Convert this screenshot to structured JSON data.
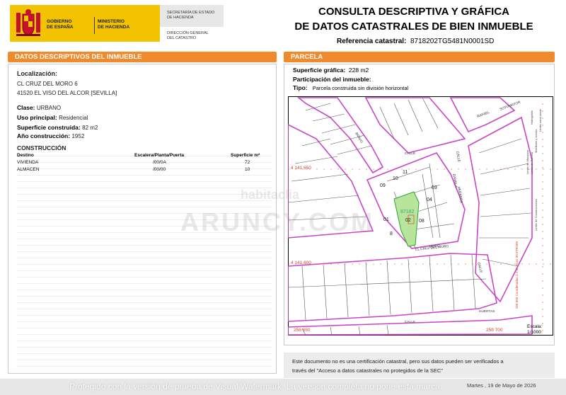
{
  "header": {
    "gov_line1": "GOBIERNO",
    "gov_line2": "DE ESPAÑA",
    "ministry_line1": "MINISTERIO",
    "ministry_line2": "DE HACIENDA",
    "secretaria_line1": "SECRETARÍA DE ESTADO",
    "secretaria_line2": "DE HACIENDA",
    "direccion_line1": "DIRECCIÓN GENERAL",
    "direccion_line2": "DEL CATASTRO",
    "title_line1": "CONSULTA DESCRIPTIVA Y GRÁFICA",
    "title_line2": "DE DATOS CATASTRALES DE BIEN INMUEBLE",
    "ref_label": "Referencia catastral:",
    "ref_value": "8718202TG5481N0001SD",
    "accent_color": "#f08a2c",
    "gov_color": "#f3c200"
  },
  "left": {
    "section_title": "DATOS DESCRIPTIVOS DEL INMUEBLE",
    "localizacion_label": "Localización:",
    "address_line1": "CL CRUZ DEL MORO 6",
    "address_line2": "41520 EL VISO DEL ALCOR [SEVILLA]",
    "clase_label": "Clase:",
    "clase_value": "URBANO",
    "uso_label": "Uso principal:",
    "uso_value": "Residencial",
    "sup_label": "Superficie construida:",
    "sup_value": "82 m2",
    "ano_label": "Año construcción:",
    "ano_value": "1952",
    "construccion_label": "CONSTRUCCIÓN",
    "table": {
      "headers": [
        "Destino",
        "Escalera/Planta/Puerta",
        "Superficie m²"
      ],
      "rows": [
        [
          "VIVIENDA",
          "/00/0A",
          "72"
        ],
        [
          "ALMACEN",
          "/00/00",
          "10"
        ]
      ]
    }
  },
  "right": {
    "section_title": "PARCELA",
    "sup_label": "Superficie gráfica:",
    "sup_value": "228 m2",
    "part_label": "Participación del inmueble:",
    "tipo_label": "Tipo:",
    "tipo_value": "Parcela construida sin división horizontal",
    "scale_label": "Escala:",
    "scale_value": "1/1000"
  },
  "map": {
    "coord_north": "4 141 650",
    "coord_south": "4 141 600",
    "coord_bottom_left": "258 650",
    "coord_bottom_right": "258 700",
    "parcel_ref": "87182",
    "streets": [
      "CALLE",
      "RAFAEL",
      "SOTOMAYOR",
      "CALLE",
      "RAMBLA",
      "HERRERA",
      "CL CRUZ DEL MORO",
      "HUERTAS",
      "CALLE",
      "CALLE",
      "BRAVO",
      "MORO"
    ],
    "plot_numbers": [
      "09",
      "10",
      "11",
      "03",
      "04",
      "01",
      "02",
      "08",
      "8"
    ],
    "legend": [
      "Límite de Manzana",
      "Límite de Parcela",
      "Límite de Construcciones",
      "Mobiliario y aceras",
      "Límite zona verde",
      "Hidrografía"
    ],
    "side_note": "258 650 Coordenadas U.T.M. Huso 30 ETRS89",
    "line_color": "#c946c9"
  },
  "notice": {
    "line1": "Este documento no es una certificación catastral, pero sus datos pueden ser verificados a",
    "line2": "través del \"Acceso a datos catastrales no protegidos de la SEC\""
  },
  "footer": {
    "date": "Martes , 19 de Mayo de 2026"
  },
  "watermark": {
    "brand_top": "habitaclia",
    "brand_main": "ARUNCY.COM",
    "bottom_text": "Protegido con la versión de prueba de Visual Watermark. La versión completa no pone esta marca."
  }
}
